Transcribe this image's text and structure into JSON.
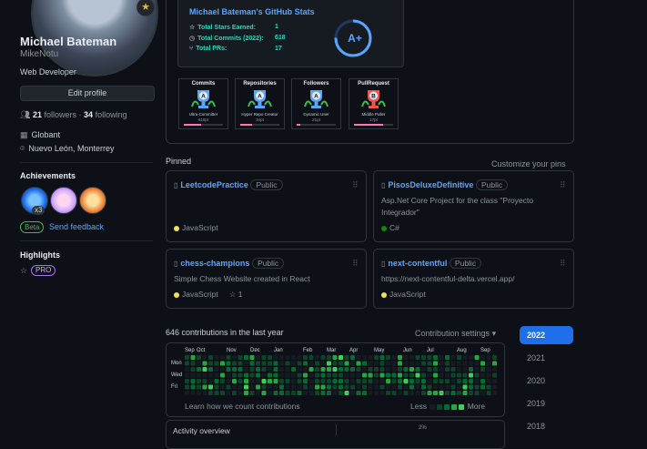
{
  "profile": {
    "name": "Michael Bateman",
    "login": "MikeNotu",
    "bio": "Web Developer",
    "edit_label": "Edit profile",
    "followers_count": "21",
    "followers_label": "followers",
    "separator": "·",
    "following_count": "34",
    "following_label": "following",
    "company": "Globant",
    "location": "Nuevo León, Monterrey"
  },
  "achievements": {
    "title": "Achievements",
    "count_badge": "x3",
    "beta_label": "Beta",
    "feedback_label": "Send feedback"
  },
  "highlights": {
    "title": "Highlights",
    "pro_label": "PRO"
  },
  "stats_card": {
    "title": "Michael Bateman's GitHub Stats",
    "rows": [
      {
        "label": "Total Stars Earned:",
        "value": "1"
      },
      {
        "label": "Total Commits (2022):",
        "value": "618"
      },
      {
        "label": "Total PRs:",
        "value": "17"
      }
    ],
    "grade": "A+"
  },
  "trophies": [
    {
      "title": "Commits",
      "rank": "A",
      "subtitle": "Ultra Committer",
      "points": "618pt",
      "progress": 0.45,
      "color": "#58a6ff"
    },
    {
      "title": "Repositories",
      "rank": "A",
      "subtitle": "Hyper Repo Creator",
      "points": "34pt",
      "progress": 0.3,
      "color": "#58a6ff"
    },
    {
      "title": "Followers",
      "rank": "A",
      "subtitle": "Dynamic User",
      "points": "21pt",
      "progress": 0.1,
      "color": "#58a6ff"
    },
    {
      "title": "PullRequest",
      "rank": "B",
      "subtitle": "Middle Puller",
      "points": "17pt",
      "progress": 0.75,
      "color": "#f85149"
    }
  ],
  "pinned": {
    "title": "Pinned",
    "customize_label": "Customize your pins",
    "repos": [
      {
        "name": "LeetcodePractice",
        "visibility": "Public",
        "description": "",
        "language": "JavaScript",
        "language_color": "#f1e05a",
        "stars": ""
      },
      {
        "name": "PisosDeluxeDefinitive",
        "visibility": "Public",
        "description": "Asp.Net Core Project for the class \"Proyecto Integrador\"",
        "language": "C#",
        "language_color": "#178600",
        "stars": ""
      },
      {
        "name": "chess-champions",
        "visibility": "Public",
        "description": "Simple Chess Website created in React",
        "language": "JavaScript",
        "language_color": "#f1e05a",
        "stars": "1"
      },
      {
        "name": "next-contentful",
        "visibility": "Public",
        "description": "https://next-contentful-delta.vercel.app/",
        "language": "JavaScript",
        "language_color": "#f1e05a",
        "stars": ""
      }
    ]
  },
  "contributions": {
    "title": "646 contributions in the last year",
    "settings_label": "Contribution settings",
    "months": [
      "Sep",
      "Oct",
      "Nov",
      "Dec",
      "Jan",
      "Feb",
      "Mar",
      "Apr",
      "May",
      "Jun",
      "Jul",
      "Aug",
      "Sep"
    ],
    "days": [
      "Mon",
      "Wed",
      "Fri"
    ],
    "learn_label": "Learn how we count contributions",
    "less_label": "Less",
    "more_label": "More",
    "legend_colors": [
      "#161b22",
      "#0e4429",
      "#006d32",
      "#26a641",
      "#39d353"
    ]
  },
  "years": [
    "2022",
    "2021",
    "2020",
    "2019",
    "2018"
  ],
  "activity": {
    "title": "Activity overview",
    "percent": "2%"
  }
}
